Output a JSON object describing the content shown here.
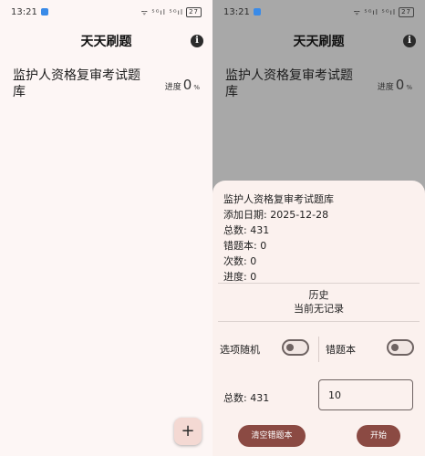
{
  "status": {
    "time": "13:21",
    "signal": "ᯤ ⁵ᴳıl ⁵ᴳıl",
    "battery": "27"
  },
  "app": {
    "title": "天天刷题",
    "info_icon": "i"
  },
  "bank": {
    "title": "监护人资格复审考试题库",
    "progress_label": "进度",
    "progress_value": "0",
    "progress_unit": "%"
  },
  "fab": {
    "label": "+"
  },
  "sheet": {
    "details": [
      "监护人资格复审考试题库",
      "添加日期: 2025-12-28",
      "总数: 431",
      "错题本: 0",
      "次数: 0",
      "进度: 0"
    ],
    "history_title": "历史",
    "history_empty": "当前无记录",
    "random_label": "选项随机",
    "wrongbook_label": "错题本",
    "total_label": "总数: 431",
    "count_value": "10",
    "clear_button": "清空错题本",
    "start_button": "开始"
  },
  "colors": {
    "accent": "#8b4a43",
    "background": "#fdf6f5",
    "scrim": "#a8a8a8",
    "sheet": "#fbf1ee"
  }
}
